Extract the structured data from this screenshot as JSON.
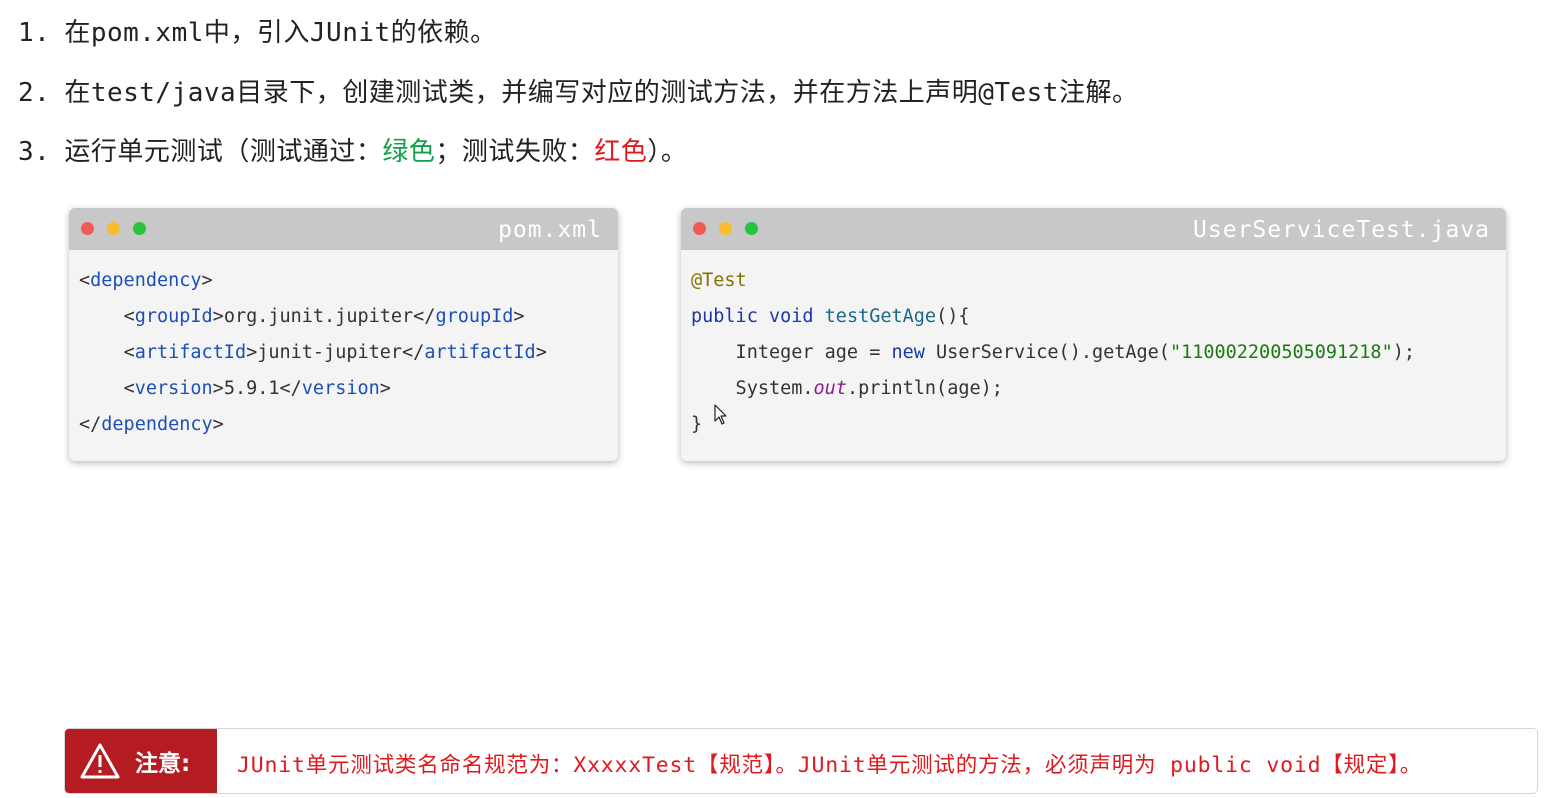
{
  "steps": [
    {
      "num": "1.",
      "text": "在pom.xml中，引入JUnit的依赖。"
    },
    {
      "num": "2.",
      "text": "在test/java目录下，创建测试类，并编写对应的测试方法，并在方法上声明@Test注解。"
    },
    {
      "num": "3.",
      "text_a": "运行单元测试（测试通过：",
      "green": "绿色",
      "text_b": "；测试失败：",
      "red": "红色",
      "text_c": "）。"
    }
  ],
  "pom_window": {
    "filename": "pom.xml",
    "lines": [
      {
        "o1": "<",
        "t1": "dependency",
        "c1": ">"
      },
      {
        "indent": "    ",
        "o1": "<",
        "t1": "groupId",
        "c1": ">",
        "val": "org.junit.jupiter",
        "o2": "</",
        "t2": "groupId",
        "c2": ">"
      },
      {
        "indent": "    ",
        "o1": "<",
        "t1": "artifactId",
        "c1": ">",
        "val": "junit-jupiter",
        "o2": "</",
        "t2": "artifactId",
        "c2": ">"
      },
      {
        "indent": "    ",
        "o1": "<",
        "t1": "version",
        "c1": ">",
        "val": "5.9.1",
        "o2": "</",
        "t2": "version",
        "c2": ">"
      },
      {
        "o1": "</",
        "t1": "dependency",
        "c1": ">"
      }
    ]
  },
  "test_window": {
    "filename": "UserServiceTest.java",
    "annotation": "@Test",
    "sig_kw": "public void",
    "sig_name": "testGetAge",
    "sig_rest": "(){",
    "l3_type": "    Integer age = ",
    "l3_new": "new",
    "l3_rest": " UserService().getAge(",
    "l3_str": "\"110002200505091218\"",
    "l3_end": ");",
    "l4_a": "    System.",
    "l4_field": "out",
    "l4_b": ".println(age);",
    "close": "}"
  },
  "notice": {
    "label": "注意:",
    "text": "JUnit单元测试类名命名规范为：XxxxxTest【规范】。JUnit单元测试的方法，必须声明为 public void【规定】。"
  },
  "colors": {
    "accent_red": "#b41c21",
    "pass_green": "#13a04a",
    "fail_red": "#e0191f"
  },
  "icons": [
    "warning-icon",
    "mouse-cursor-icon"
  ]
}
